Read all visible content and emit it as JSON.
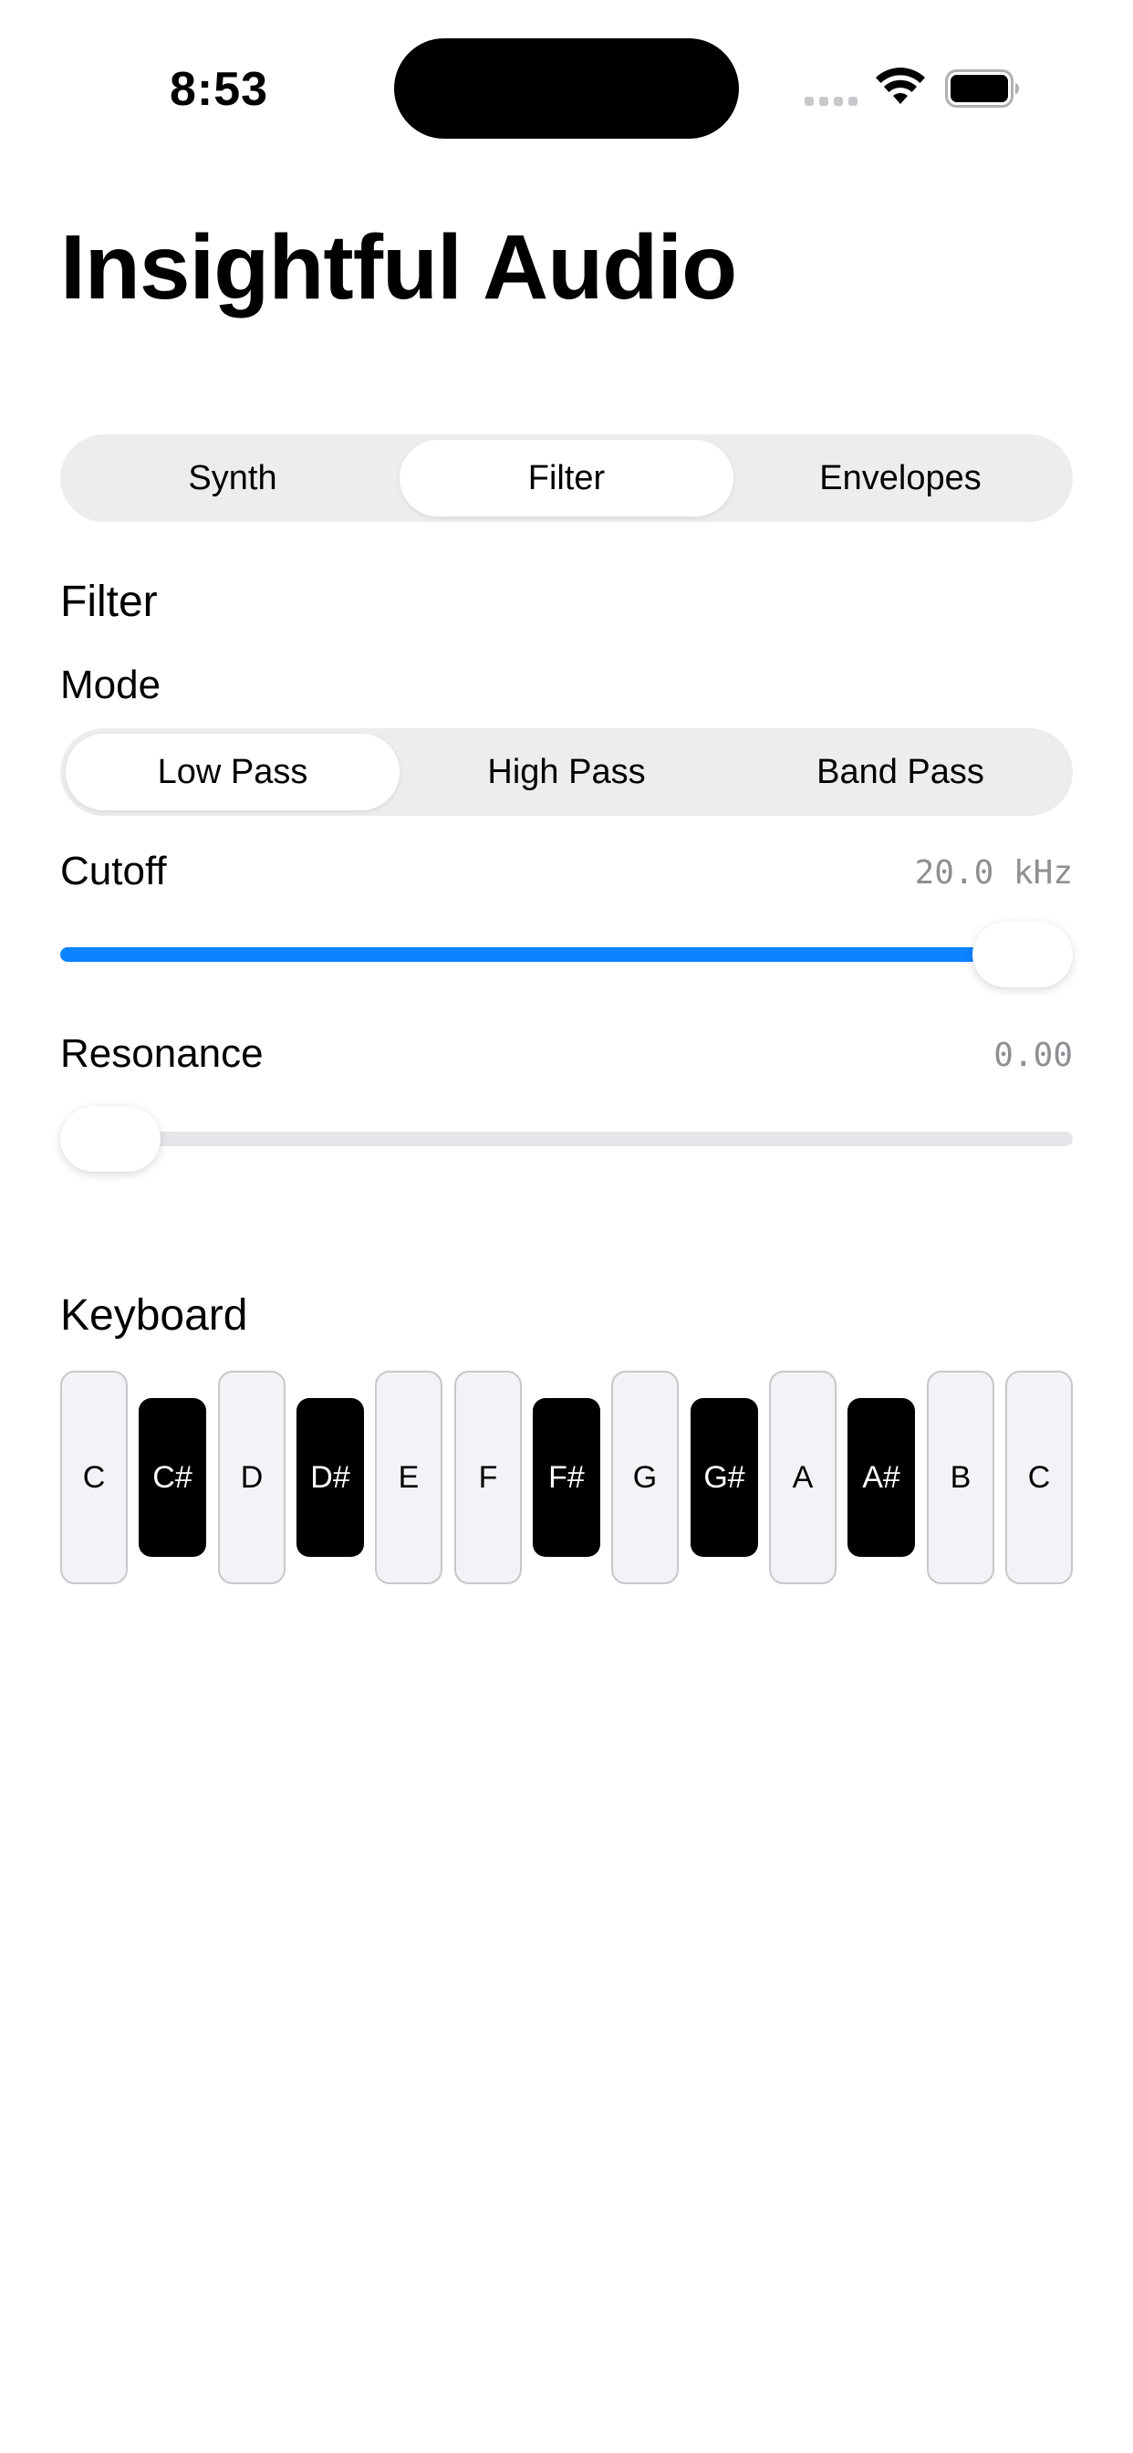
{
  "status_bar": {
    "time": "8:53"
  },
  "app": {
    "title": "Insightful Audio"
  },
  "tabs": {
    "items": [
      "Synth",
      "Filter",
      "Envelopes"
    ],
    "selected": "Filter"
  },
  "filter": {
    "section_title": "Filter",
    "mode": {
      "label": "Mode",
      "options": [
        "Low Pass",
        "High Pass",
        "Band Pass"
      ],
      "selected": "Low Pass"
    },
    "cutoff": {
      "label": "Cutoff",
      "value_text": "20.0 kHz",
      "level": 1.0
    },
    "resonance": {
      "label": "Resonance",
      "value_text": "0.00",
      "level": 0.0
    }
  },
  "keyboard": {
    "title": "Keyboard",
    "keys": [
      {
        "note": "C",
        "color": "white"
      },
      {
        "note": "C#",
        "color": "black"
      },
      {
        "note": "D",
        "color": "white"
      },
      {
        "note": "D#",
        "color": "black"
      },
      {
        "note": "E",
        "color": "white"
      },
      {
        "note": "F",
        "color": "white"
      },
      {
        "note": "F#",
        "color": "black"
      },
      {
        "note": "G",
        "color": "white"
      },
      {
        "note": "G#",
        "color": "black"
      },
      {
        "note": "A",
        "color": "white"
      },
      {
        "note": "A#",
        "color": "black"
      },
      {
        "note": "B",
        "color": "white"
      },
      {
        "note": "C",
        "color": "white"
      }
    ]
  },
  "colors": {
    "accent": "#0a84ff",
    "segment_background": "#ededee",
    "secondary_text": "#8e8e93"
  },
  "icons": {
    "wifi": "wifi-icon",
    "battery": "battery-icon",
    "signal": "cellular-signal-icon"
  }
}
